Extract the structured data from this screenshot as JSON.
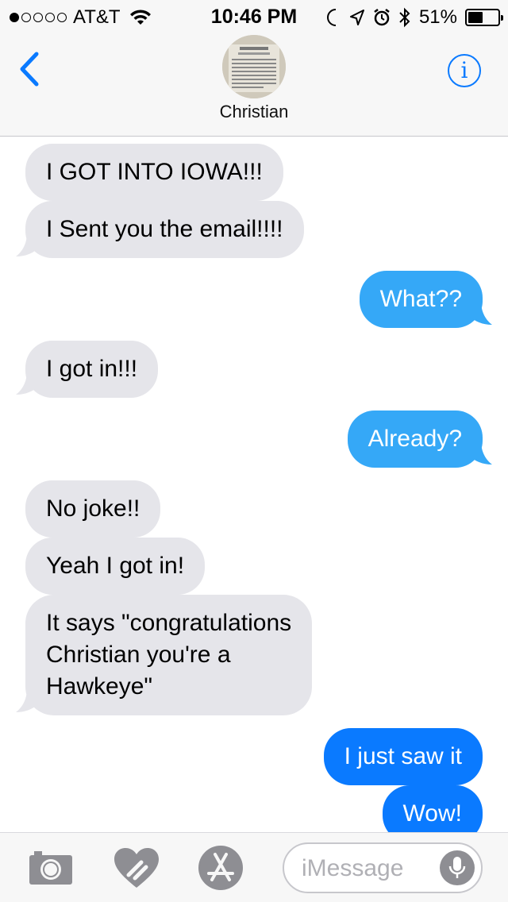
{
  "status_bar": {
    "carrier": "AT&T",
    "signal_bars": 1,
    "time": "10:46 PM",
    "battery_percent": "51%",
    "battery_level": 0.51
  },
  "header": {
    "contact_name": "Christian",
    "back_icon": "chevron-left-icon",
    "info_icon": "info-icon"
  },
  "messages": [
    {
      "direction": "in",
      "text": "I GOT INTO IOWA!!!"
    },
    {
      "direction": "in",
      "text": "I Sent you the email!!!!"
    },
    {
      "direction": "out",
      "type": "sms",
      "text": "What??"
    },
    {
      "direction": "in",
      "text": "I got in!!!"
    },
    {
      "direction": "out",
      "type": "sms",
      "text": "Already?"
    },
    {
      "direction": "in",
      "text": "No joke!!"
    },
    {
      "direction": "in",
      "text": "Yeah I got in!"
    },
    {
      "direction": "in",
      "lines": [
        "It says \"congratulations",
        "Christian you're a",
        "Hawkeye\""
      ]
    },
    {
      "direction": "out",
      "type": "imessage",
      "text": "I just saw it"
    },
    {
      "direction": "out",
      "type": "imessage",
      "text": "Wow!"
    }
  ],
  "input_bar": {
    "placeholder": "iMessage",
    "icons": [
      "camera-icon",
      "digital-touch-icon",
      "app-store-icon",
      "microphone-icon"
    ]
  },
  "colors": {
    "incoming_bubble": "#e5e5ea",
    "sms_bubble": "#35a8f7",
    "imessage_bubble": "#0a7aff",
    "tint": "#0a7aff"
  }
}
